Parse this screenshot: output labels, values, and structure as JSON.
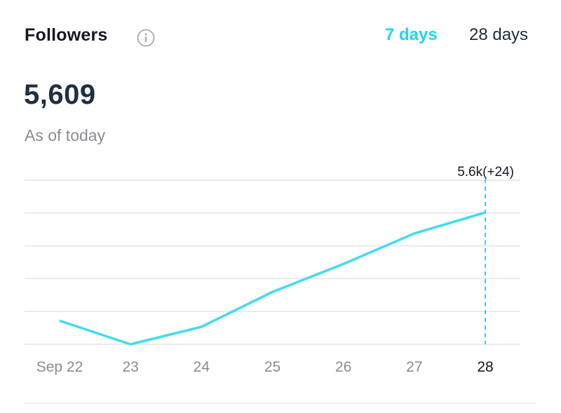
{
  "header": {
    "title": "Followers",
    "info_icon": "info-circle-icon",
    "tabs": [
      {
        "label": "7 days",
        "active": true
      },
      {
        "label": "28 days",
        "active": false
      }
    ]
  },
  "summary": {
    "value": "5,609",
    "caption": "As of today"
  },
  "colors": {
    "accent": "#20d5ec",
    "line": "#3fdcee",
    "grid": "#e3e3e4",
    "tick": "#8a8b91",
    "tick_active": "#161823"
  },
  "chart_data": {
    "type": "line",
    "title": "Followers",
    "xlabel": "",
    "ylabel": "",
    "categories": [
      "Sep 22",
      "23",
      "24",
      "25",
      "26",
      "27",
      "28"
    ],
    "series": [
      {
        "name": "Followers",
        "values": [
          5485,
          5458,
          5478,
          5518,
          5550,
          5585,
          5609
        ]
      }
    ],
    "ylim": [
      5458,
      5646
    ],
    "gridlines": 6,
    "grid": true,
    "highlight": {
      "index": 6,
      "label": "5.6k(+24)"
    },
    "active_tick_index": 6
  }
}
